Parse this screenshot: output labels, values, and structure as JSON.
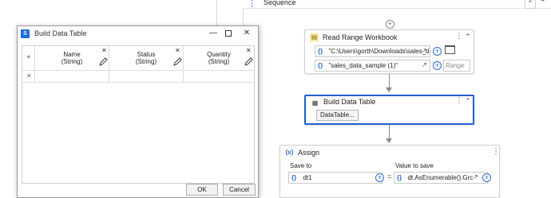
{
  "sequence": {
    "title": "Sequence",
    "icon": "sequence-icon",
    "collapse_icon": "collapse-up-icon"
  },
  "read_range": {
    "title": "Read Range Workbook",
    "icon": "excel-icon",
    "path_value": "\"C:\\Users\\gorth\\Downloads\\sales_data",
    "sheet_value": "\"sales_data_sample (1)\"",
    "range_placeholder": "Range"
  },
  "build_data_table": {
    "title": "Build Data Table",
    "icon": "datatable-icon",
    "button_label": "DataTable..."
  },
  "assign": {
    "title": "Assign",
    "icon": "assign-icon",
    "save_to_label": "Save to",
    "value_label": "Value to save",
    "save_to_value": "dt1",
    "value_value": "dt.AsEnumerable().Grc"
  },
  "dialog": {
    "title": "Build Data Table",
    "columns": [
      {
        "name": "Name",
        "type": "(String)"
      },
      {
        "name": "Status",
        "type": "(String)"
      },
      {
        "name": "Quantity",
        "type": "(String)"
      }
    ],
    "ok_label": "OK",
    "cancel_label": "Cancel"
  },
  "symbols": {
    "braces": "{}",
    "plus": "+",
    "close": "×",
    "dots": "⋮",
    "chevron_up": "︽",
    "equals": "="
  }
}
